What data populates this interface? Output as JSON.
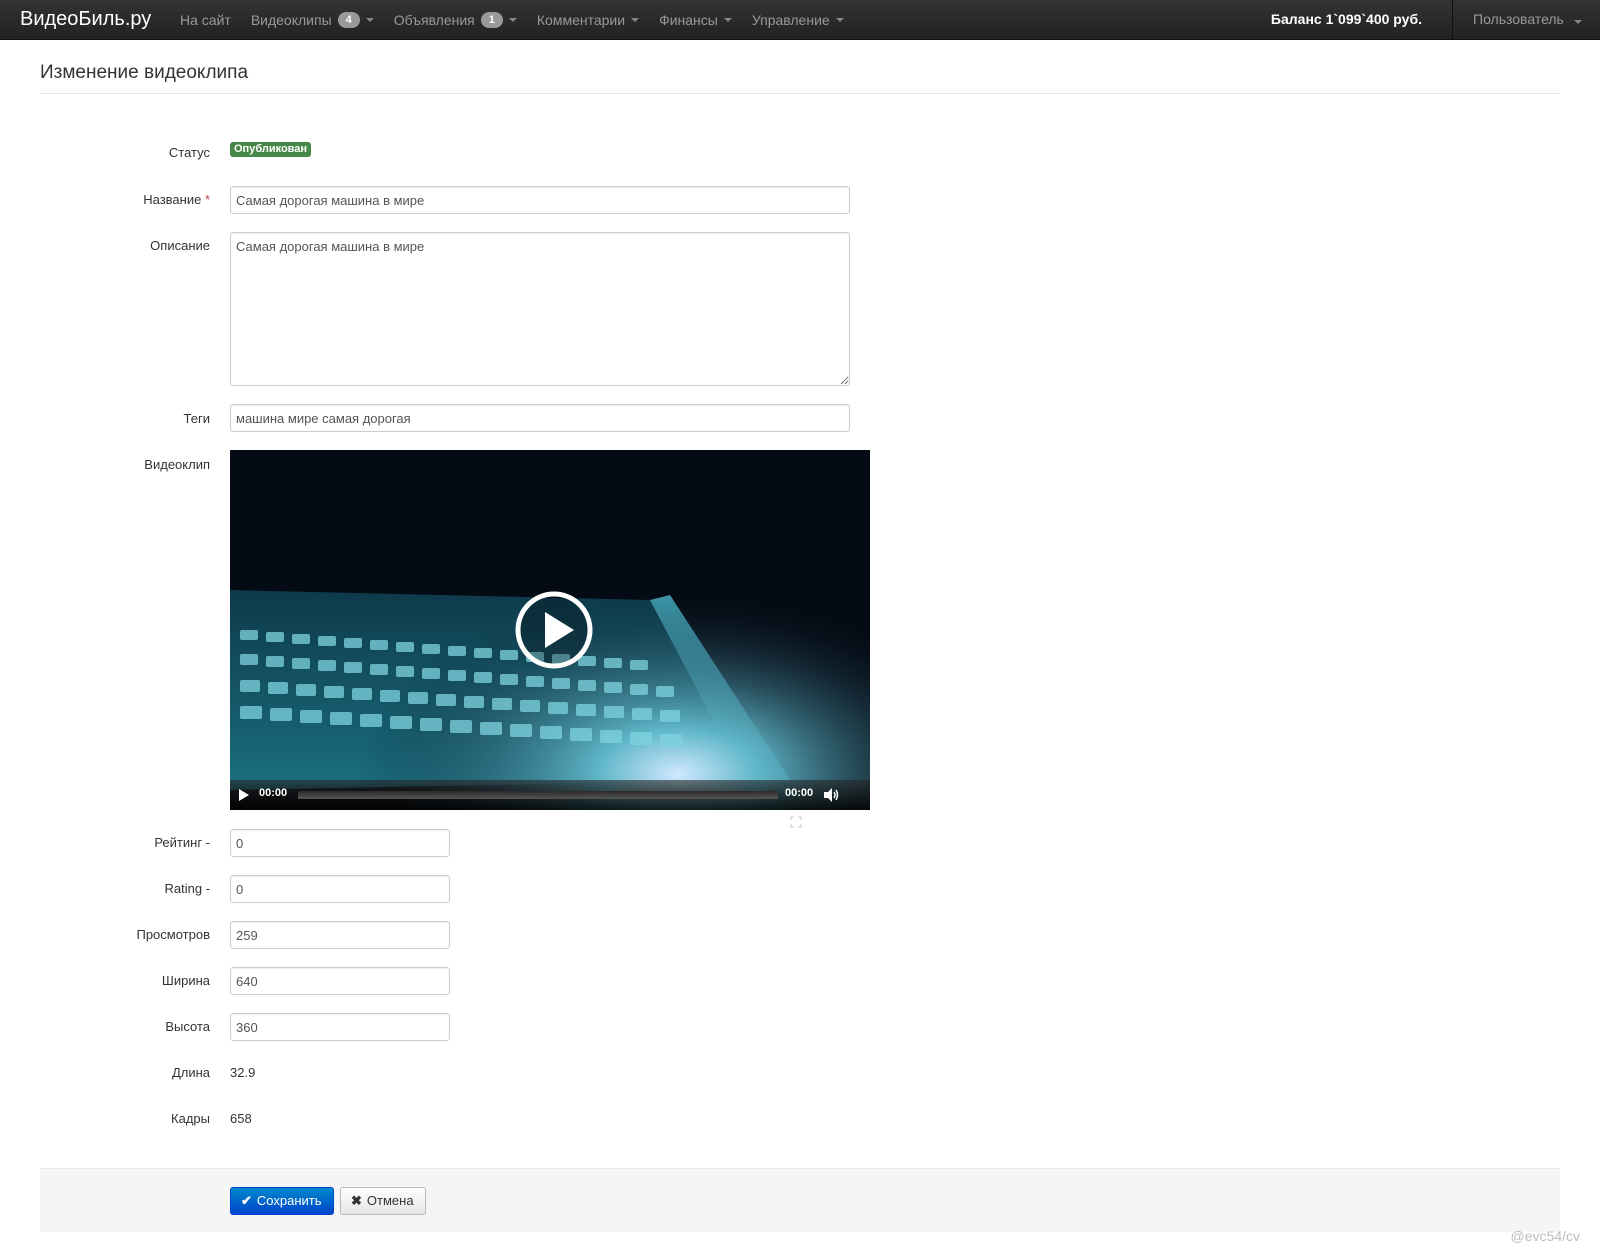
{
  "navbar": {
    "brand": "ВидеоБиль.ру",
    "items": [
      {
        "label": "На сайт"
      },
      {
        "label": "Видеоклипы",
        "badge": "4"
      },
      {
        "label": "Объявления",
        "badge": "1"
      },
      {
        "label": "Комментарии"
      },
      {
        "label": "Финансы"
      },
      {
        "label": "Управление"
      }
    ],
    "balance": "Баланс 1`099`400 руб.",
    "user": "Пользователь"
  },
  "page": {
    "title": "Изменение видеоклипа"
  },
  "form": {
    "status_label": "Статус",
    "status_value": "Опубликован",
    "name_label": "Название",
    "required_mark": "*",
    "name_value": "Самая дорогая машина в мире",
    "description_label": "Описание",
    "description_value": "Самая дорогая машина в мире",
    "tags_label": "Теги",
    "tags_value": "машина мире самая дорогая",
    "video_label": "Видеоклип",
    "rating_ru_label": "Рейтинг -",
    "rating_ru_value": "0",
    "rating_en_label": "Rating -",
    "rating_en_value": "0",
    "views_label": "Просмотров",
    "views_value": "259",
    "width_label": "Ширина",
    "width_value": "640",
    "height_label": "Высота",
    "height_value": "360",
    "length_label": "Длина",
    "length_value": "32.9",
    "frames_label": "Кадры",
    "frames_value": "658"
  },
  "video_player": {
    "current_time": "00:00",
    "duration": "00:00",
    "progress": 0
  },
  "actions": {
    "save_label": "Сохранить",
    "cancel_label": "Отмена"
  },
  "watermark": "@evc54/cv",
  "colors": {
    "status_published": "#468847",
    "primary": "#0044cc"
  }
}
